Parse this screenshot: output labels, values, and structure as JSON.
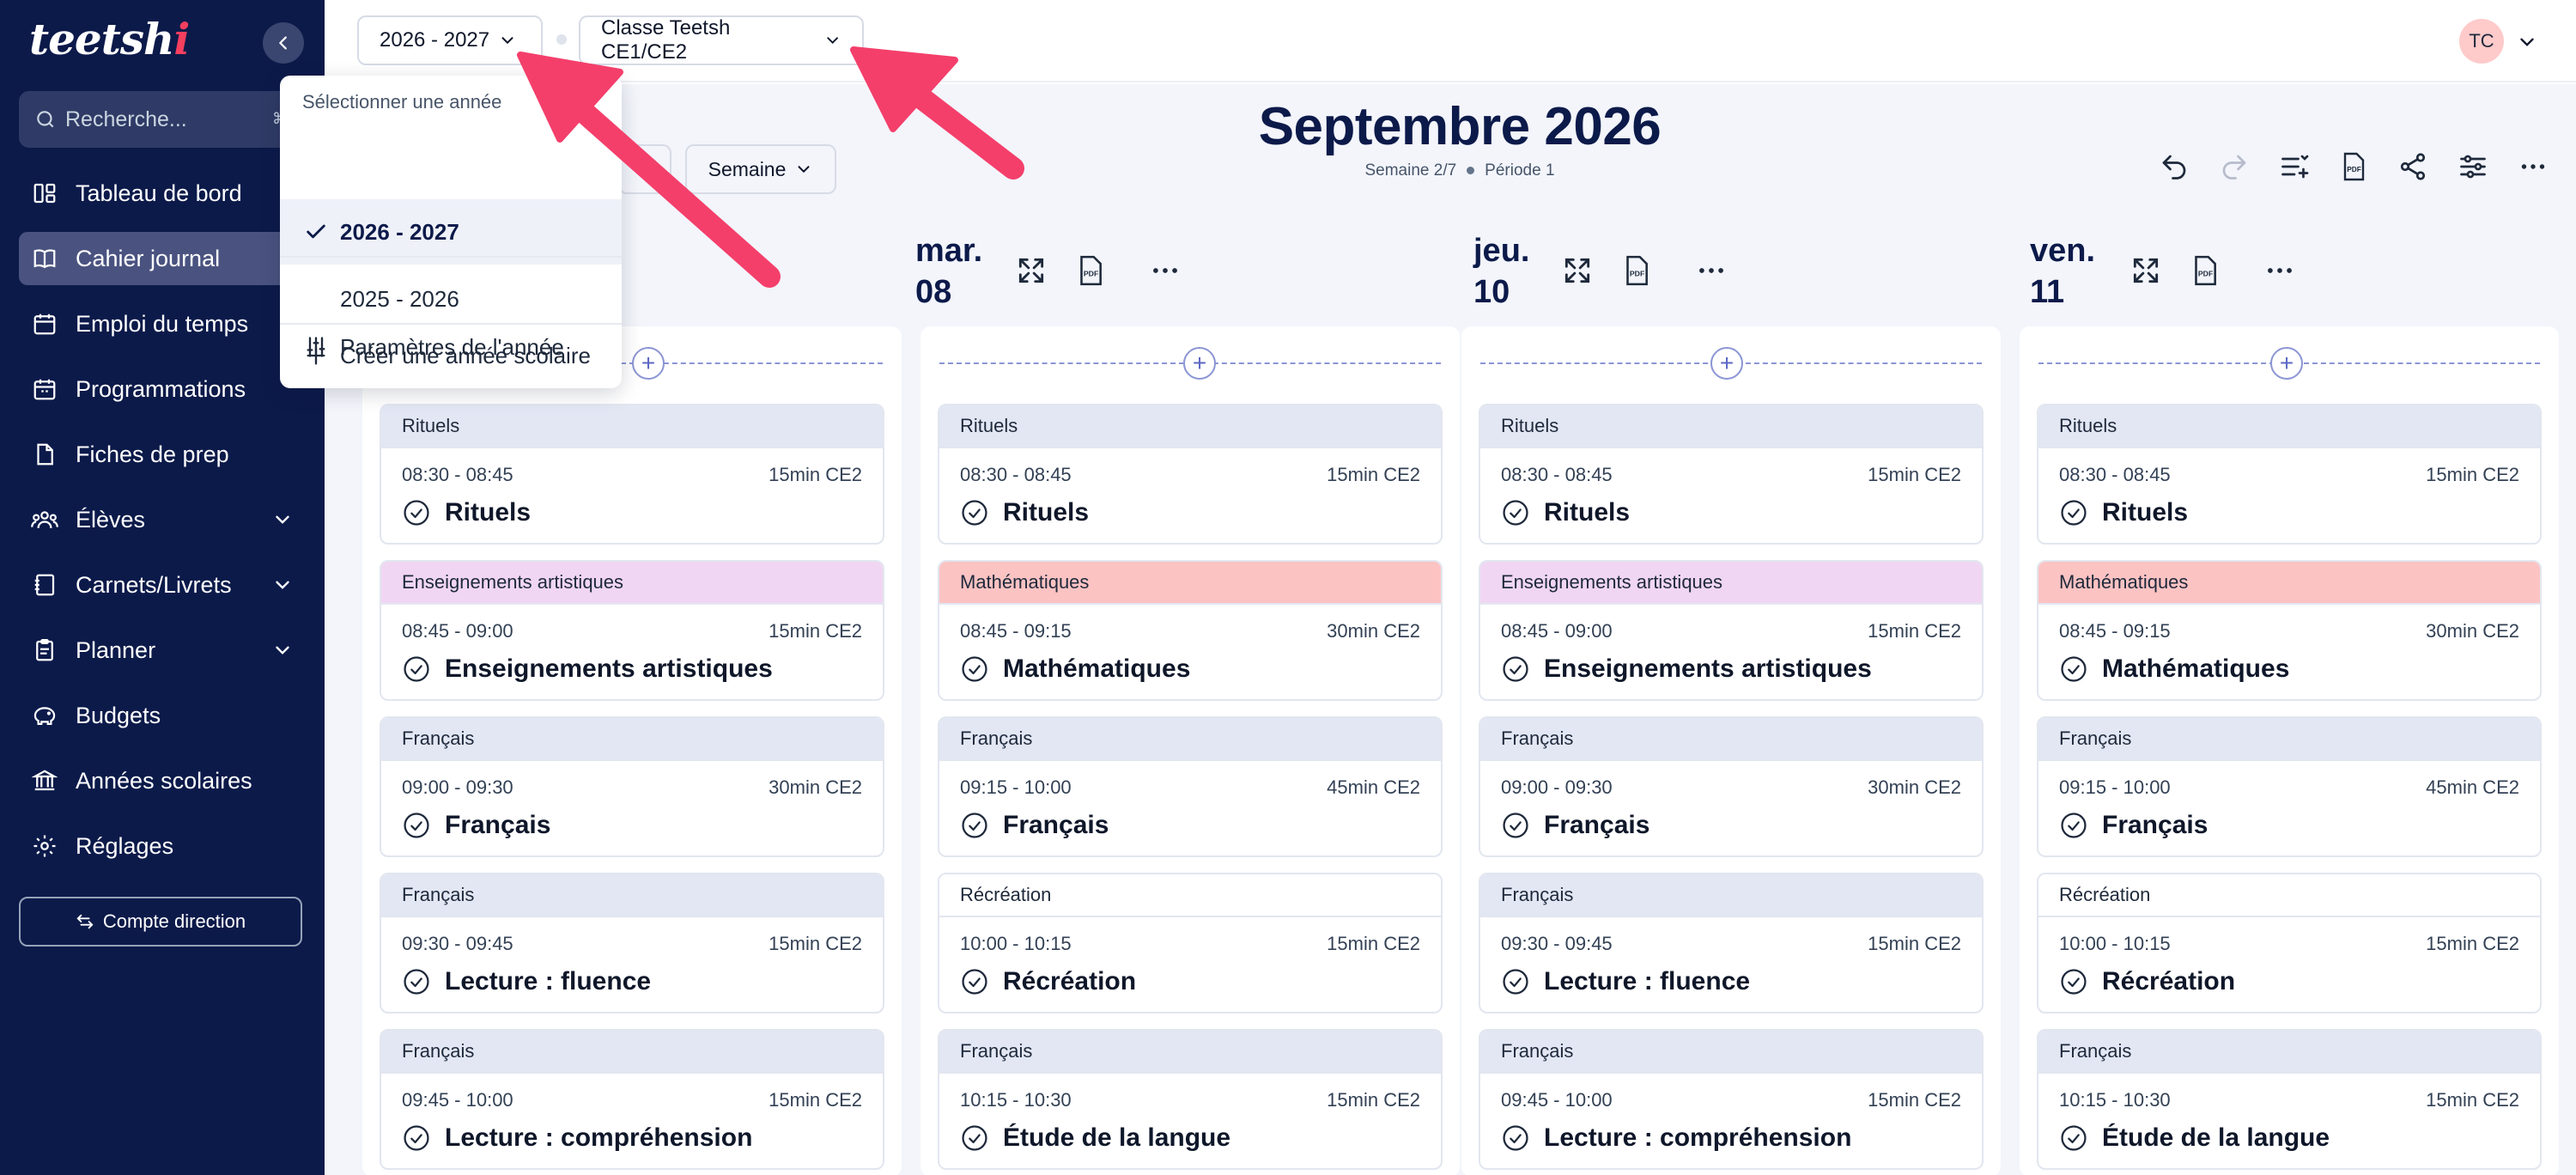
{
  "app": {
    "logo": "teetsh",
    "logo_dot": "i"
  },
  "sidebar": {
    "search_placeholder": "Recherche...",
    "search_shortcut": "⌘ K",
    "items": [
      {
        "label": "Tableau de bord",
        "icon": "dashboard-icon"
      },
      {
        "label": "Cahier journal",
        "icon": "book-icon",
        "active": true
      },
      {
        "label": "Emploi du temps",
        "icon": "calendar-icon"
      },
      {
        "label": "Programmations",
        "icon": "calendar-grid-icon"
      },
      {
        "label": "Fiches de prep",
        "icon": "file-icon"
      },
      {
        "label": "Élèves",
        "icon": "users-icon",
        "expandable": true
      },
      {
        "label": "Carnets/Livrets",
        "icon": "notebook-icon",
        "expandable": true
      },
      {
        "label": "Planner",
        "icon": "clipboard-icon",
        "expandable": true
      },
      {
        "label": "Budgets",
        "icon": "piggy-bank-icon"
      },
      {
        "label": "Années scolaires",
        "icon": "school-icon"
      },
      {
        "label": "Réglages",
        "icon": "gear-icon"
      }
    ],
    "compte_button": "Compte direction"
  },
  "topbar": {
    "year_select": "2026 - 2027",
    "class_select": "Classe Teetsh CE1/CE2",
    "avatar": "TC"
  },
  "dropdown": {
    "heading": "Sélectionner une année",
    "years": [
      {
        "label": "2026 - 2027",
        "selected": true
      },
      {
        "label": "2025 - 2026",
        "selected": false
      }
    ],
    "settings": "Paramètres de l'année",
    "create": "Créer une année scolaire"
  },
  "header": {
    "month": "Septembre 2026",
    "week": "Semaine 2/7",
    "period": "Période 1",
    "view_select": "Semaine"
  },
  "days": [
    {
      "name": "",
      "num": "",
      "slots": [
        {
          "category": "Rituels",
          "type": "rituels",
          "time": "08:30 - 08:45",
          "duration": "15min CE2",
          "title": "Rituels"
        },
        {
          "category": "Enseignements artistiques",
          "type": "art",
          "time": "08:45 - 09:00",
          "duration": "15min CE2",
          "title": "Enseignements artistiques"
        },
        {
          "category": "Français",
          "type": "fr",
          "time": "09:00 - 09:30",
          "duration": "30min CE2",
          "title": "Français"
        },
        {
          "category": "Français",
          "type": "fr",
          "time": "09:30 - 09:45",
          "duration": "15min CE2",
          "title": "Lecture : fluence"
        },
        {
          "category": "Français",
          "type": "fr",
          "time": "09:45 - 10:00",
          "duration": "15min CE2",
          "title": "Lecture : compréhension"
        }
      ]
    },
    {
      "name": "mar.",
      "num": "08",
      "slots": [
        {
          "category": "Rituels",
          "type": "rituels",
          "time": "08:30 - 08:45",
          "duration": "15min CE2",
          "title": "Rituels"
        },
        {
          "category": "Mathématiques",
          "type": "math",
          "time": "08:45 - 09:15",
          "duration": "30min CE2",
          "title": "Mathématiques"
        },
        {
          "category": "Français",
          "type": "fr",
          "time": "09:15 - 10:00",
          "duration": "45min CE2",
          "title": "Français"
        },
        {
          "category": "Récréation",
          "type": "rec",
          "time": "10:00 - 10:15",
          "duration": "15min CE2",
          "title": "Récréation"
        },
        {
          "category": "Français",
          "type": "fr",
          "time": "10:15 - 10:30",
          "duration": "15min CE2",
          "title": "Étude de la langue"
        }
      ]
    },
    {
      "name": "jeu.",
      "num": "10",
      "slots": [
        {
          "category": "Rituels",
          "type": "rituels",
          "time": "08:30 - 08:45",
          "duration": "15min CE2",
          "title": "Rituels"
        },
        {
          "category": "Enseignements artistiques",
          "type": "art",
          "time": "08:45 - 09:00",
          "duration": "15min CE2",
          "title": "Enseignements artistiques"
        },
        {
          "category": "Français",
          "type": "fr",
          "time": "09:00 - 09:30",
          "duration": "30min CE2",
          "title": "Français"
        },
        {
          "category": "Français",
          "type": "fr",
          "time": "09:30 - 09:45",
          "duration": "15min CE2",
          "title": "Lecture : fluence"
        },
        {
          "category": "Français",
          "type": "fr",
          "time": "09:45 - 10:00",
          "duration": "15min CE2",
          "title": "Lecture : compréhension"
        }
      ]
    },
    {
      "name": "ven.",
      "num": "11",
      "slots": [
        {
          "category": "Rituels",
          "type": "rituels",
          "time": "08:30 - 08:45",
          "duration": "15min CE2",
          "title": "Rituels"
        },
        {
          "category": "Mathématiques",
          "type": "math",
          "time": "08:45 - 09:15",
          "duration": "30min CE2",
          "title": "Mathématiques"
        },
        {
          "category": "Français",
          "type": "fr",
          "time": "09:15 - 10:00",
          "duration": "45min CE2",
          "title": "Français"
        },
        {
          "category": "Récréation",
          "type": "rec",
          "time": "10:00 - 10:15",
          "duration": "15min CE2",
          "title": "Récréation"
        },
        {
          "category": "Français",
          "type": "fr",
          "time": "10:15 - 10:30",
          "duration": "15min CE2",
          "title": "Étude de la langue"
        }
      ]
    }
  ],
  "colors": {
    "sidebar": "#0c1a4a",
    "accent_arrow": "#f43f6b",
    "rituels": "#e3e7f4",
    "art": "#f0d6f2",
    "math": "#fcc3c3"
  }
}
